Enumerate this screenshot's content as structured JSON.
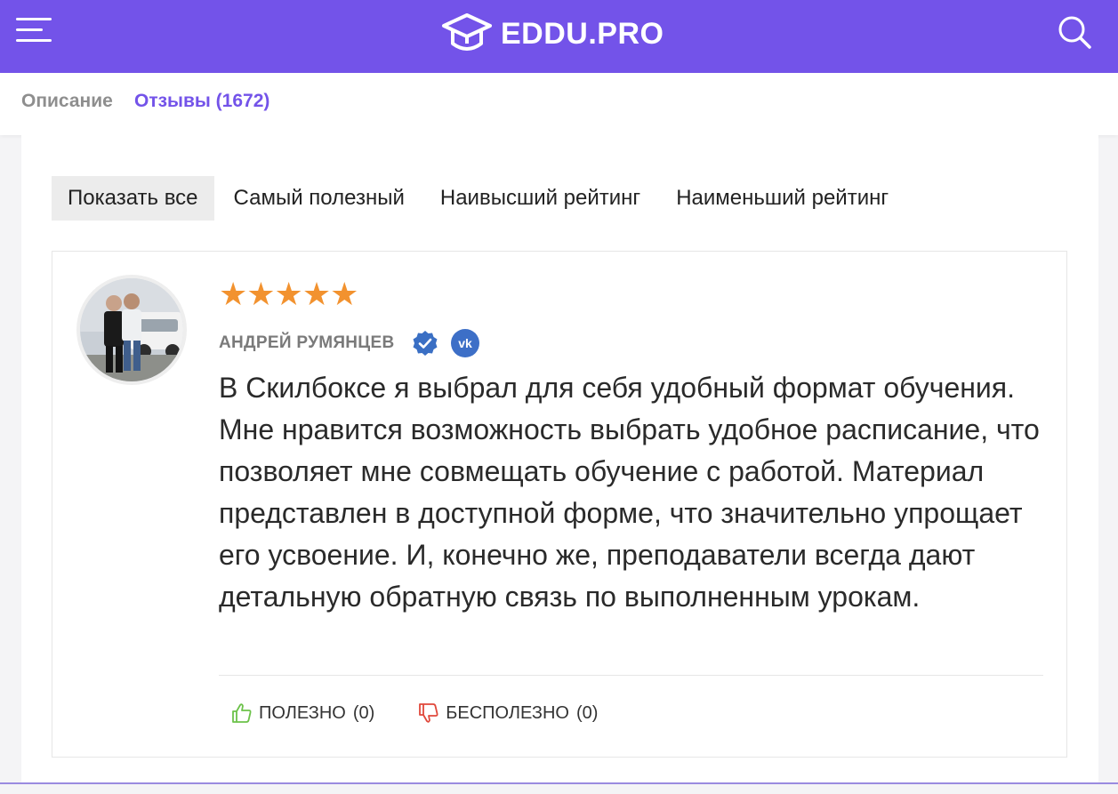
{
  "header": {
    "logo_text": "EDDU.PRO",
    "brand_color": "#7353e9",
    "menu_icon": "hamburger-menu-icon",
    "search_icon": "search-icon"
  },
  "tabs": {
    "description_label": "Описание",
    "reviews_label": "Отзывы (1672)",
    "active": "reviews"
  },
  "filters": [
    {
      "label": "Показать все",
      "active": true
    },
    {
      "label": "Самый полезный",
      "active": false
    },
    {
      "label": "Наивысший рейтинг",
      "active": false
    },
    {
      "label": "Наименьший рейтинг",
      "active": false
    }
  ],
  "review": {
    "rating": 5,
    "stars": "★★★★★",
    "star_color": "#f2922f",
    "author": "АНДРЕЙ РУМЯНЦЕВ",
    "verified_icon": "verified-badge-icon",
    "social_icon": "vk-icon",
    "text": "В Скилбоксе я выбрал для себя удобный формат обучения. Мне нравится возможность выбрать удобное расписание, что позволяет мне совмещать обучение с работой. Материал представлен в доступной форме, что значительно упрощает его усвоение. И, конечно же, преподаватели всегда дают детальную обратную связь по выполненным урокам.",
    "helpful_label": "ПОЛЕЗНО",
    "helpful_count": "(0)",
    "unhelpful_label": "БЕСПОЛЕЗНО",
    "unhelpful_count": "(0)"
  }
}
